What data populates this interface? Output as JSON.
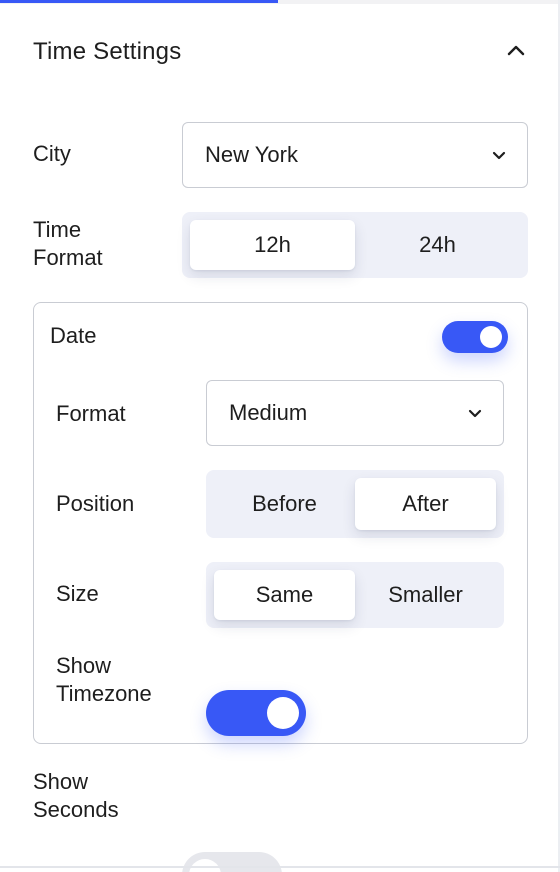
{
  "header": {
    "title": "Time Settings"
  },
  "city": {
    "label": "City",
    "value": "New York"
  },
  "time_format": {
    "label_line1": "Time",
    "label_line2": "Format",
    "options": [
      "12h",
      "24h"
    ],
    "selected": "12h"
  },
  "date": {
    "label": "Date",
    "enabled": true,
    "format": {
      "label": "Format",
      "value": "Medium"
    },
    "position": {
      "label": "Position",
      "options": [
        "Before",
        "After"
      ],
      "selected": "After"
    },
    "size": {
      "label": "Size",
      "options": [
        "Same",
        "Smaller"
      ],
      "selected": "Same"
    },
    "show_timezone": {
      "label_line1": "Show",
      "label_line2": "Timezone",
      "enabled": true
    }
  },
  "show_seconds": {
    "label_line1": "Show",
    "label_line2": "Seconds",
    "enabled": false
  },
  "colors": {
    "accent": "#3858f6",
    "segment_bg": "#eef0f8",
    "toggle_off": "#e6e7ec",
    "border": "#c9ccd3"
  }
}
